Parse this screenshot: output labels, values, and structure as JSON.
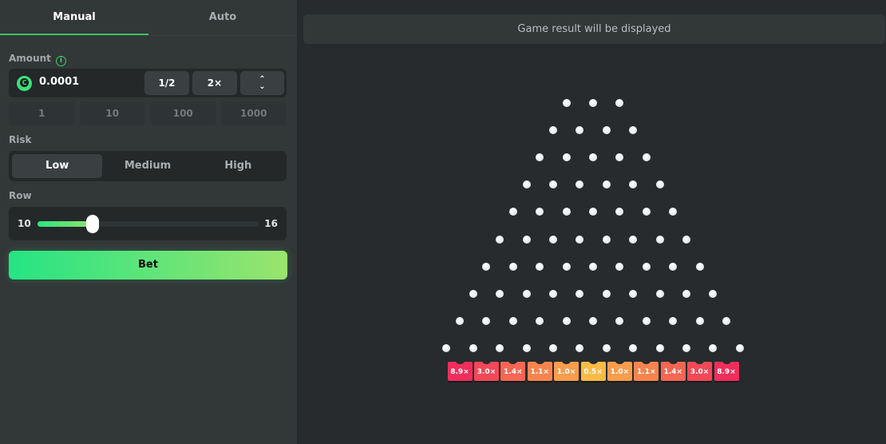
{
  "tabs": [
    {
      "label": "Manual",
      "active": true
    },
    {
      "label": "Auto",
      "active": false
    }
  ],
  "amount": {
    "label": "Amount",
    "info_icon": "info-icon",
    "currency_icon": "coin-icon",
    "value": "0.0001",
    "half_label": "1/2",
    "double_label": "2×",
    "up_arrow": "⌃",
    "down_arrow": "⌄",
    "presets": [
      "1",
      "10",
      "100",
      "1000"
    ]
  },
  "risk": {
    "label": "Risk",
    "options": [
      "Low",
      "Medium",
      "High"
    ],
    "selected": "Low"
  },
  "row": {
    "label": "Row",
    "value_label": "10",
    "max_label": "16",
    "min": 8,
    "max": 16,
    "value": 10
  },
  "bet_label": "Bet",
  "result_text": "Game result will be displayed",
  "board": {
    "rows": 10,
    "multipliers": [
      "8.9×",
      "3.0×",
      "1.4×",
      "1.1×",
      "1.0×",
      "0.5×",
      "1.0×",
      "1.1×",
      "1.4×",
      "3.0×",
      "8.9×"
    ],
    "bucket_colors": [
      "#f02e5b",
      "#f24857",
      "#f56653",
      "#f7844f",
      "#f99c4b",
      "#fbbb44",
      "#f99c4b",
      "#f7844f",
      "#f56653",
      "#f24857",
      "#f02e5b"
    ]
  },
  "colors": {
    "accent": "#3bc05e",
    "sidebar_bg": "#323738",
    "main_bg": "#272b2d"
  }
}
